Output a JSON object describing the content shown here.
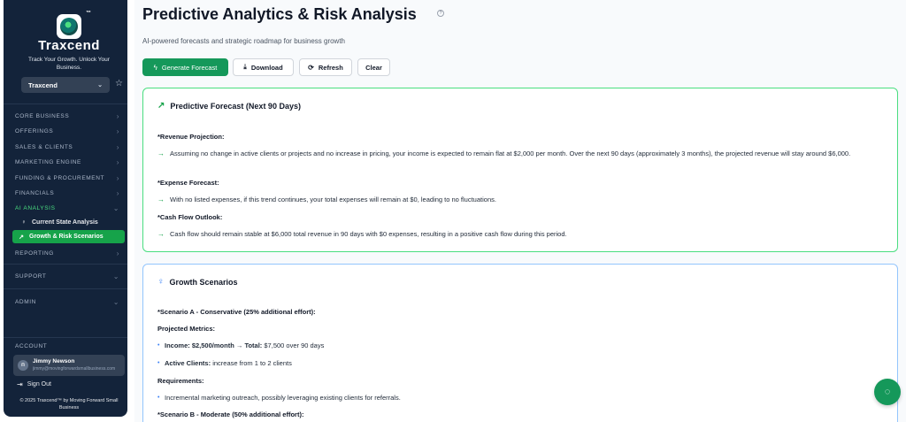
{
  "sidebar": {
    "brand": "Traxcend",
    "tm": "™",
    "tagline": "Track Your Growth. Unlock Your Business.",
    "org_select": "Traxcend",
    "nav": [
      {
        "label": "CORE BUSINESS"
      },
      {
        "label": "OFFERINGS"
      },
      {
        "label": "SALES & CLIENTS"
      },
      {
        "label": "MARKETING ENGINE"
      },
      {
        "label": "FUNDING & PROCUREMENT"
      },
      {
        "label": "FINANCIALS"
      },
      {
        "label": "AI ANALYSIS"
      },
      {
        "label": "REPORTING"
      },
      {
        "label": "SUPPORT"
      },
      {
        "label": "ADMIN"
      }
    ],
    "ai_sub": [
      {
        "label": "Current State Analysis",
        "icon": "lightbulb-icon"
      },
      {
        "label": "Growth & Risk Scenarios",
        "icon": "trending-up-icon"
      }
    ],
    "account_label": "ACCOUNT",
    "user_name": "Jimmy Newson",
    "user_email": "jimmy@movingforwardsmallbusiness.com",
    "sign_out": "Sign Out",
    "copyright": "© 2025 Traxcend™ by Moving Forward Small Business"
  },
  "header": {
    "title": "Predictive Analytics & Risk Analysis",
    "subtitle": "AI-powered forecasts and strategic roadmap for business growth"
  },
  "toolbar": {
    "generate": "Generate Forecast",
    "download": "Download",
    "refresh": "Refresh",
    "clear": "Clear"
  },
  "forecast": {
    "title": "Predictive Forecast (Next 90 Days)",
    "revenue_label": "*Revenue Projection:",
    "revenue_text": "Assuming no change in active clients or projects and no increase in pricing, your income is expected to remain flat at $2,000 per month. Over the next 90 days (approximately 3 months), the projected revenue will stay around $6,000.",
    "expense_label": "*Expense Forecast:",
    "expense_text": "With no listed expenses, if this trend continues, your total expenses will remain at $0, leading to no fluctuations.",
    "cashflow_label": "*Cash Flow Outlook:",
    "cashflow_text": "Cash flow should remain stable at $6,000 total revenue in 90 days with $0 expenses, resulting in a positive cash flow during this period."
  },
  "growth": {
    "title": "Growth Scenarios",
    "scenario_a": "*Scenario A - Conservative (25% additional effort):",
    "projected_metrics": "Projected Metrics:",
    "income_label": "Income: $2,500/month → Total:",
    "income_value": "$7,500 over 90 days",
    "clients_label": "Active Clients:",
    "clients_value": "increase from 1 to 2 clients",
    "requirements": "Requirements:",
    "req_1": "Incremental marketing outreach, possibly leveraging existing clients for referrals.",
    "scenario_b": "*Scenario B - Moderate (50% additional effort):"
  },
  "colors": {
    "accent": "#15985a",
    "sidebar_bg": "#13233a",
    "forecast_border": "#4ade80",
    "growth_border": "#93c5fd"
  }
}
